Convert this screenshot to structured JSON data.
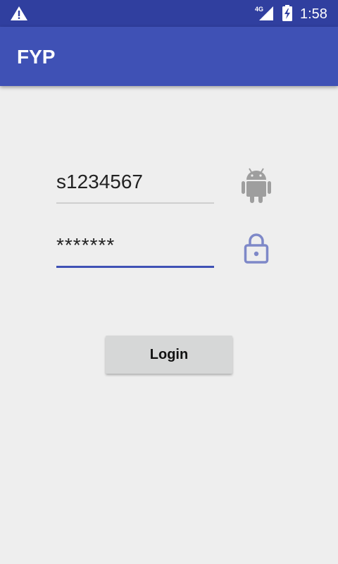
{
  "status_bar": {
    "network_label": "4G",
    "time": "1:58",
    "icons": [
      "warning-icon",
      "signal-icon",
      "battery-charging-icon"
    ]
  },
  "app_bar": {
    "title": "FYP",
    "color": "#3f51b5"
  },
  "form": {
    "username": {
      "value": "s1234567",
      "icon": "android-icon"
    },
    "password": {
      "value": "*******",
      "icon": "lock-icon"
    },
    "login_label": "Login"
  },
  "colors": {
    "primary": "#3f51b5",
    "primary_dark": "#303f9f",
    "background": "#eeeeee",
    "button": "#d6d7d7",
    "icon_grey": "#9e9e9e",
    "icon_accent": "#7e88c8"
  }
}
